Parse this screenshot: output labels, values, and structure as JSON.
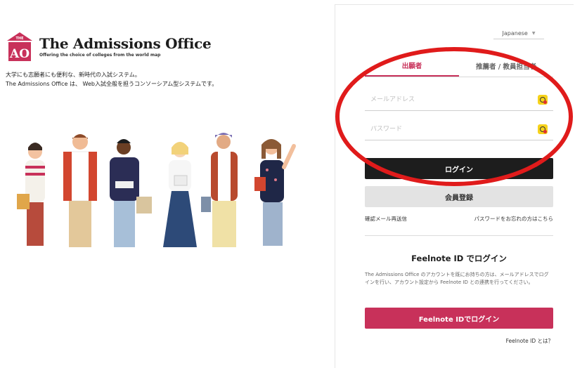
{
  "brand": {
    "logo_letters": "AO",
    "logo_top": "THE",
    "title": "The Admissions Office",
    "subtitle": "Offering the choice of colleges from the world map"
  },
  "intro": {
    "line1": "大学にも志願者にも便利な、新時代の入試システム。",
    "line2": "The Admissions Office は、 Web入試全般を担うコンソーシアム型システムです。"
  },
  "language": {
    "selected": "Japanese"
  },
  "tabs": [
    {
      "label": "出願者",
      "active": true
    },
    {
      "label": "推薦者 / 教員担当者",
      "active": false
    }
  ],
  "form": {
    "email_placeholder": "メールアドレス",
    "password_placeholder": "パスワード",
    "login_label": "ログイン",
    "register_label": "会員登録",
    "resend_link": "確認メール再送信",
    "forgot_link": "パスワードをお忘れの方はこちら"
  },
  "feelnote": {
    "title": "Feelnote ID でログイン",
    "description": "The Admissions Office のアカウントを既にお持ちの方は、メールアドレスでログインを行い、アカウント設定から Feelnote ID との連携を行ってください。",
    "button_label": "Feelnote IDでログイン",
    "help_link": "Feelnote ID とは？"
  },
  "colors": {
    "accent": "#c8315a",
    "dark_button": "#1d1d1d",
    "annotation": "#e01b1b"
  }
}
